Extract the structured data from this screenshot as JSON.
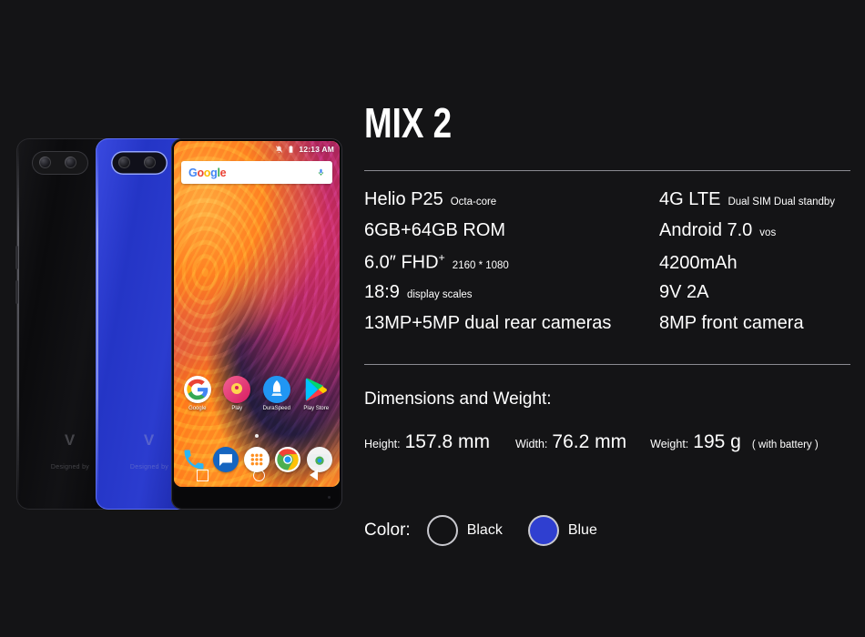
{
  "product": {
    "title": "MIX 2"
  },
  "specs": {
    "rows": [
      {
        "left": {
          "main": "Helio P25",
          "sub": "Octa-core"
        },
        "right": {
          "main": "4G LTE",
          "sub": "Dual SIM Dual standby"
        }
      },
      {
        "left": {
          "main": "6GB+64GB ROM",
          "sub": ""
        },
        "right": {
          "main": "Android 7.0",
          "sub": "vos"
        }
      },
      {
        "left": {
          "main": "6.0″  FHD",
          "sup": "+",
          "sub": "2160 * 1080"
        },
        "right": {
          "main": "4200mAh",
          "sub": ""
        }
      },
      {
        "left": {
          "main": "18:9",
          "sub": "display scales"
        },
        "right": {
          "main": "9V 2A",
          "sub": ""
        }
      },
      {
        "left": {
          "main": "13MP+5MP dual rear cameras",
          "sub": ""
        },
        "right": {
          "main": "8MP front camera",
          "sub": ""
        }
      }
    ]
  },
  "dimensions": {
    "heading": "Dimensions and Weight:",
    "height_label": "Height:",
    "height_value": "157.8 mm",
    "width_label": "Width:",
    "width_value": "76.2 mm",
    "weight_label": "Weight:",
    "weight_value": "195 g",
    "weight_note": "( with battery )"
  },
  "color": {
    "label": "Color:",
    "options": [
      {
        "name": "Black",
        "hex": "#131315"
      },
      {
        "name": "Blue",
        "hex": "#2f3fd0"
      }
    ]
  },
  "phone_screen": {
    "status_clock": "12:13 AM",
    "search_placeholder": "Google",
    "apps": [
      {
        "label": "Google"
      },
      {
        "label": "Play"
      },
      {
        "label": "DuraSpeed"
      },
      {
        "label": "Play Store"
      }
    ]
  },
  "phone_backs": {
    "logo_mark": "V",
    "designed_text": "Designed by"
  },
  "theme": {
    "background": "#141416",
    "text": "#ffffff",
    "divider": "#8b8b91"
  }
}
